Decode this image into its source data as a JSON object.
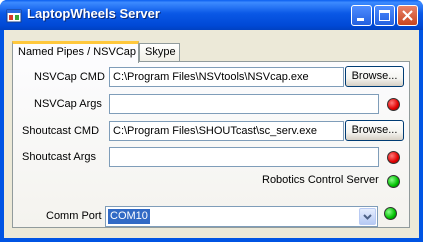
{
  "window": {
    "title": "LaptopWheels Server",
    "icon": "app-window-icon",
    "controls": [
      "minimize-icon",
      "maximize-icon",
      "close-icon"
    ]
  },
  "tabs": [
    {
      "label": "Named Pipes / NSVCap",
      "selected": true
    },
    {
      "label": "Skype",
      "selected": false
    }
  ],
  "panel": {
    "nsvcap_cmd": {
      "label": "NSVCap CMD",
      "value": "C:\\Program Files\\NSVtools\\NSVcap.exe",
      "button": "Browse..."
    },
    "nsvcap_args": {
      "label": "NSVCap Args",
      "value": "",
      "status": "red"
    },
    "shoutcast_cmd": {
      "label": "Shoutcast CMD",
      "value": "C:\\Program Files\\SHOUTcast\\sc_serv.exe",
      "button": "Browse..."
    },
    "shoutcast_args": {
      "label": "Shoutcast Args",
      "value": "",
      "status": "red"
    },
    "robotics": {
      "label": "Robotics Control Server",
      "status": "green"
    }
  },
  "comm_port": {
    "label": "Comm Port",
    "value": "COM10",
    "status": "green"
  },
  "colors": {
    "status_red": "#e00000",
    "status_green": "#00c000",
    "title_bar": "#0054e3",
    "selection": "#316ac5"
  }
}
